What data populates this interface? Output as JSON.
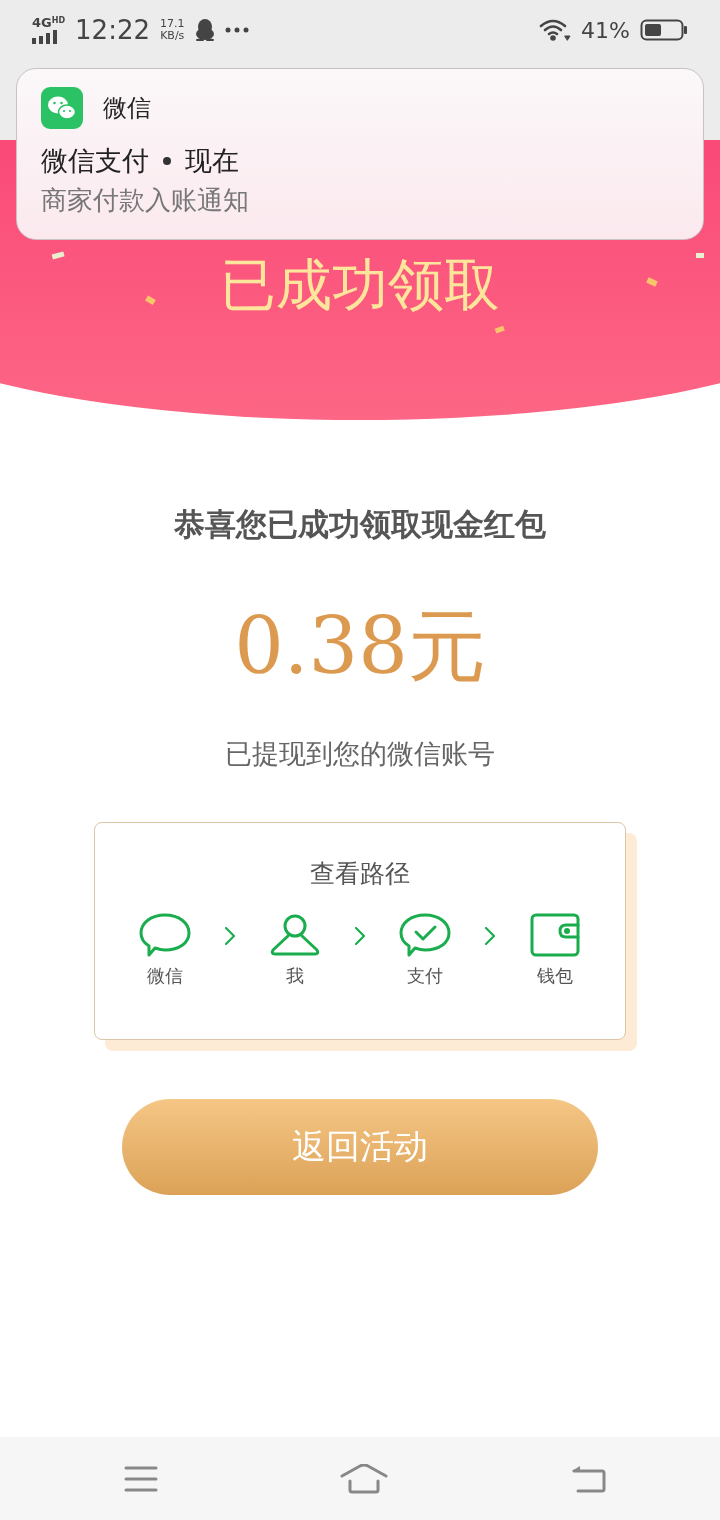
{
  "status_bar": {
    "network": "4G",
    "network_badge": "HD",
    "time": "12:22",
    "speed": "17.1",
    "speed_unit": "KB/s",
    "battery": "41%"
  },
  "notification": {
    "app": "微信",
    "title": "微信支付",
    "time": "现在",
    "body": "商家付款入账通知"
  },
  "header": {
    "title": "已成功领取"
  },
  "headline": "恭喜您已成功领取现金红包",
  "amount": "0.38元",
  "subtitle": "已提现到您的微信账号",
  "path_card": {
    "title": "查看路径",
    "steps": [
      {
        "kind": "chat",
        "label": "微信"
      },
      {
        "kind": "person",
        "label": "我"
      },
      {
        "kind": "pay",
        "label": "支付"
      },
      {
        "kind": "wallet",
        "label": "钱包"
      }
    ]
  },
  "button": "返回活动"
}
